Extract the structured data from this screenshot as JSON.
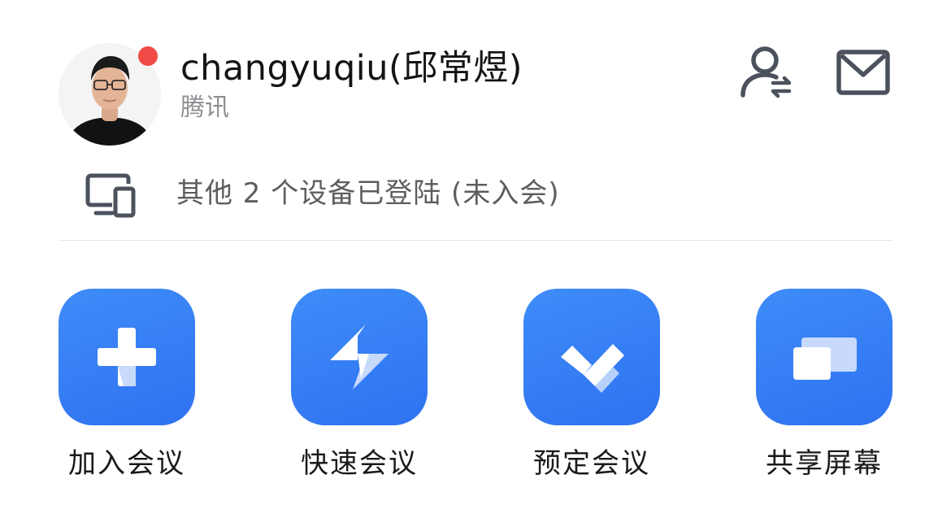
{
  "profile": {
    "name": "changyuqiu(邱常煜)",
    "organization": "腾讯",
    "status_color": "#ef4a45"
  },
  "header_icons": {
    "switch_account": "switch-account-icon",
    "mail": "mail-icon"
  },
  "devices": {
    "icon": "devices-icon",
    "text": "其他 2 个设备已登陆 (未入会)"
  },
  "actions": [
    {
      "label": "加入会议",
      "icon": "plus-icon"
    },
    {
      "label": "快速会议",
      "icon": "lightning-icon"
    },
    {
      "label": "预定会议",
      "icon": "checkmark-icon"
    },
    {
      "label": "共享屏幕",
      "icon": "share-screen-icon"
    }
  ],
  "colors": {
    "accent": "#2f72f0",
    "divider": "#e3e4e6",
    "icon_stroke": "#4b525c"
  }
}
